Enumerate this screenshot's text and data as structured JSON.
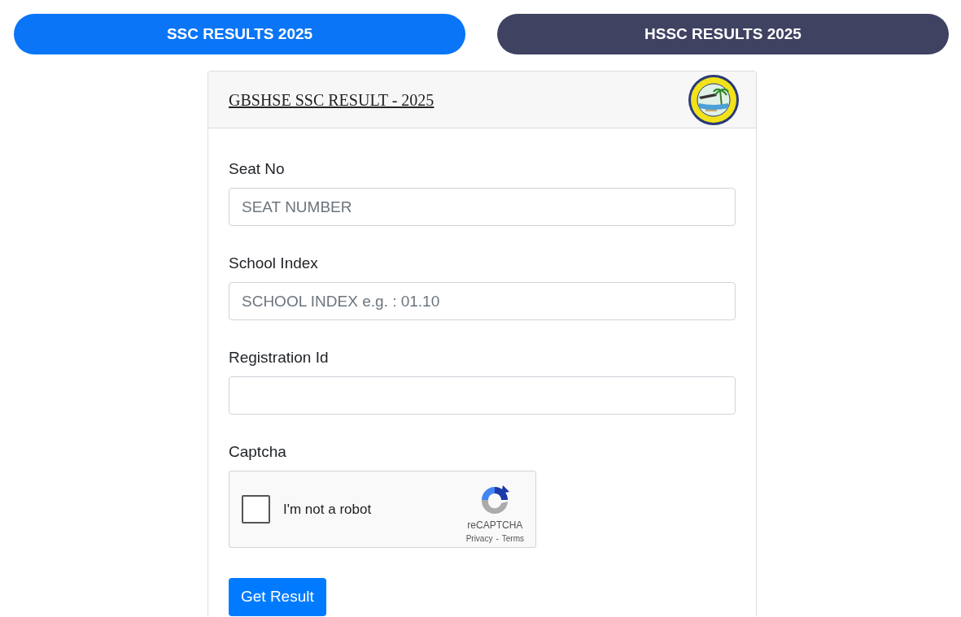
{
  "tabs": [
    {
      "label": "SSC RESULTS 2025",
      "selected": true
    },
    {
      "label": "HSSC RESULTS 2025",
      "selected": false
    }
  ],
  "card": {
    "title": "GBSHSE SSC RESULT - 2025"
  },
  "fields": [
    {
      "label": "Seat No",
      "placeholder": "SEAT NUMBER"
    },
    {
      "label": "School Index",
      "placeholder": "SCHOOL INDEX e.g. : 01.10"
    },
    {
      "label": "Registration Id"
    }
  ],
  "captcha": {
    "label": "Captcha",
    "checked": false,
    "text": "I'm not a robot",
    "brand": "reCAPTCHA",
    "links": [
      "Privacy",
      "Terms"
    ],
    "separator": "-"
  },
  "submit": {
    "label": "Get Result"
  }
}
